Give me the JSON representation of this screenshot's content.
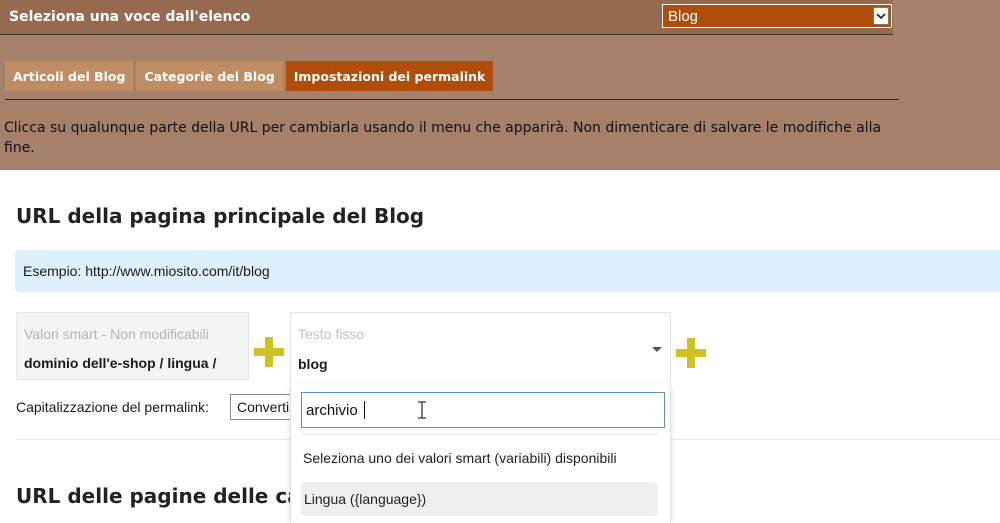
{
  "header": {
    "title": "Seleziona una voce dall'elenco",
    "select_value": "Blog"
  },
  "tabs": [
    {
      "label": "Articoli del Blog",
      "active": false
    },
    {
      "label": "Categorie del Blog",
      "active": false
    },
    {
      "label": "Impostazioni dei permalink",
      "active": true
    }
  ],
  "hint": "Clicca su qualunque parte della URL per cambiarla usando il menu che apparirà. Non dimenticare di salvare le modifiche alla fine.",
  "section": {
    "title": "URL della pagina principale del Blog",
    "example": "Esempio: http://www.miosito.com/it/blog",
    "smart_label": "Valori smart - Non modificabili",
    "smart_value": "dominio dell'e-shop / lingua /",
    "fixed_label": "Testo fisso",
    "fixed_value": "blog",
    "capitalization_label": "Capitalizzazione del permalink:",
    "capitalization_value": "Converti"
  },
  "dropdown": {
    "search_value": "archivio",
    "group_label": "Seleziona uno dei valori smart (variabili) disponibili",
    "option": "Lingua ({language})"
  },
  "section2": {
    "title": "URL delle pagine delle ca"
  },
  "colors": {
    "header_bg": "#a5806a",
    "active_tab": "#b14d0b",
    "inactive_tab": "#c08c63",
    "example_bg": "#dff0fd",
    "plus": "#cfc21e"
  },
  "icons": {
    "select_arrow": "chevron-down-icon",
    "plus": "plus-icon",
    "text_cursor": "i-beam-cursor-icon"
  }
}
